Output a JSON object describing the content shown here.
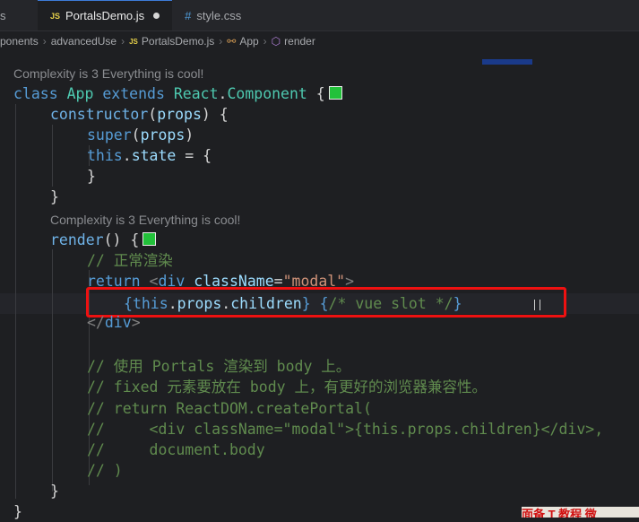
{
  "tabs": [
    {
      "label": "s",
      "active": false
    },
    {
      "label": "PortalsDemo.js",
      "icon": "JS",
      "active": true,
      "modified": true
    },
    {
      "label": "style.css",
      "icon": "#",
      "active": false
    }
  ],
  "breadcrumb": {
    "items": [
      "ponents",
      "advancedUse",
      "PortalsDemo.js",
      "App",
      "render"
    ],
    "js_icon": "JS"
  },
  "codelens": {
    "class_lens": "Complexity is 3 Everything is cool!",
    "render_lens": "Complexity is 3 Everything is cool!"
  },
  "code": {
    "l1": {
      "t1": "class",
      "t2": "App",
      "t3": "extends",
      "t4": "React",
      "t5": ".",
      "t6": "Component",
      "t7": " {"
    },
    "l2": {
      "t1": "constructor",
      "t2": "(",
      "t3": "props",
      "t4": ") {"
    },
    "l3": {
      "t1": "super",
      "t2": "(",
      "t3": "props",
      "t4": ")"
    },
    "l4": {
      "t1": "this",
      "t2": ".",
      "t3": "state",
      "t4": " = {"
    },
    "l5": "}",
    "l6": "}",
    "l7": {
      "t1": "render",
      "t2": "() {"
    },
    "l8": "// 正常渲染",
    "l9": {
      "t1": "return",
      "t2": "<",
      "t3": "div",
      "t4": "className",
      "t5": "=",
      "t6": "\"modal\"",
      "t7": ">"
    },
    "l10": {
      "t1": "{",
      "t2": "this",
      "t3": ".",
      "t4": "props",
      "t5": ".",
      "t6": "children",
      "t7": "}",
      "t8": "{",
      "t9": "/* vue slot */",
      "t10": "}"
    },
    "l11": {
      "t1": "</",
      "t2": "div",
      "t3": ">"
    },
    "l12": "// 使用 Portals 渲染到 body 上。",
    "l13": "// fixed 元素要放在 body 上，有更好的浏览器兼容性。",
    "l14": "// return ReactDOM.createPortal(",
    "l15": "//     <div className=\"modal\">{this.props.children}</div>,",
    "l16": "//     document.body",
    "l17": "// )",
    "l18": "}",
    "l19": "}"
  },
  "colors": {
    "keyword": "#569cd6",
    "class": "#4ec9b0",
    "comment": "#608b4e",
    "string": "#ce9178",
    "highlight_box": "#ee1111",
    "color_square": "#22c13a"
  },
  "banner": {
    "text": "面备 T 教程 微"
  }
}
